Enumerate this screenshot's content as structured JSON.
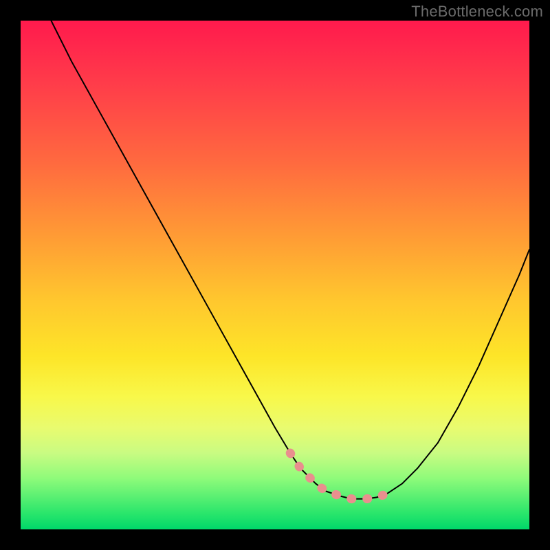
{
  "watermark": "TheBottleneck.com",
  "chart_data": {
    "type": "line",
    "title": "",
    "xlabel": "",
    "ylabel": "",
    "xlim": [
      0,
      100
    ],
    "ylim": [
      0,
      100
    ],
    "grid": false,
    "legend": false,
    "series": [
      {
        "name": "curve",
        "color": "#000000",
        "x": [
          6,
          10,
          15,
          20,
          25,
          30,
          35,
          40,
          45,
          50,
          53,
          55,
          58,
          60,
          63,
          65,
          68,
          70,
          72,
          75,
          78,
          82,
          86,
          90,
          94,
          98,
          100
        ],
        "values": [
          100,
          92,
          83,
          74,
          65,
          56,
          47,
          38,
          29,
          20,
          15,
          12,
          9,
          7.5,
          6.5,
          6,
          6,
          6.3,
          7,
          9,
          12,
          17,
          24,
          32,
          41,
          50,
          55
        ]
      }
    ],
    "highlight": {
      "name": "bottom-band",
      "color": "#e98f8e",
      "x": [
        53,
        55,
        58,
        60,
        63,
        65,
        68,
        70,
        72
      ],
      "values": [
        15,
        12,
        9,
        7.5,
        6.5,
        6,
        6,
        6.3,
        7
      ]
    },
    "background_gradient": {
      "stops": [
        {
          "pos": 0,
          "color": "#ff1a4d"
        },
        {
          "pos": 42,
          "color": "#ff9a35"
        },
        {
          "pos": 66,
          "color": "#fde528"
        },
        {
          "pos": 100,
          "color": "#00d86a"
        }
      ]
    }
  }
}
